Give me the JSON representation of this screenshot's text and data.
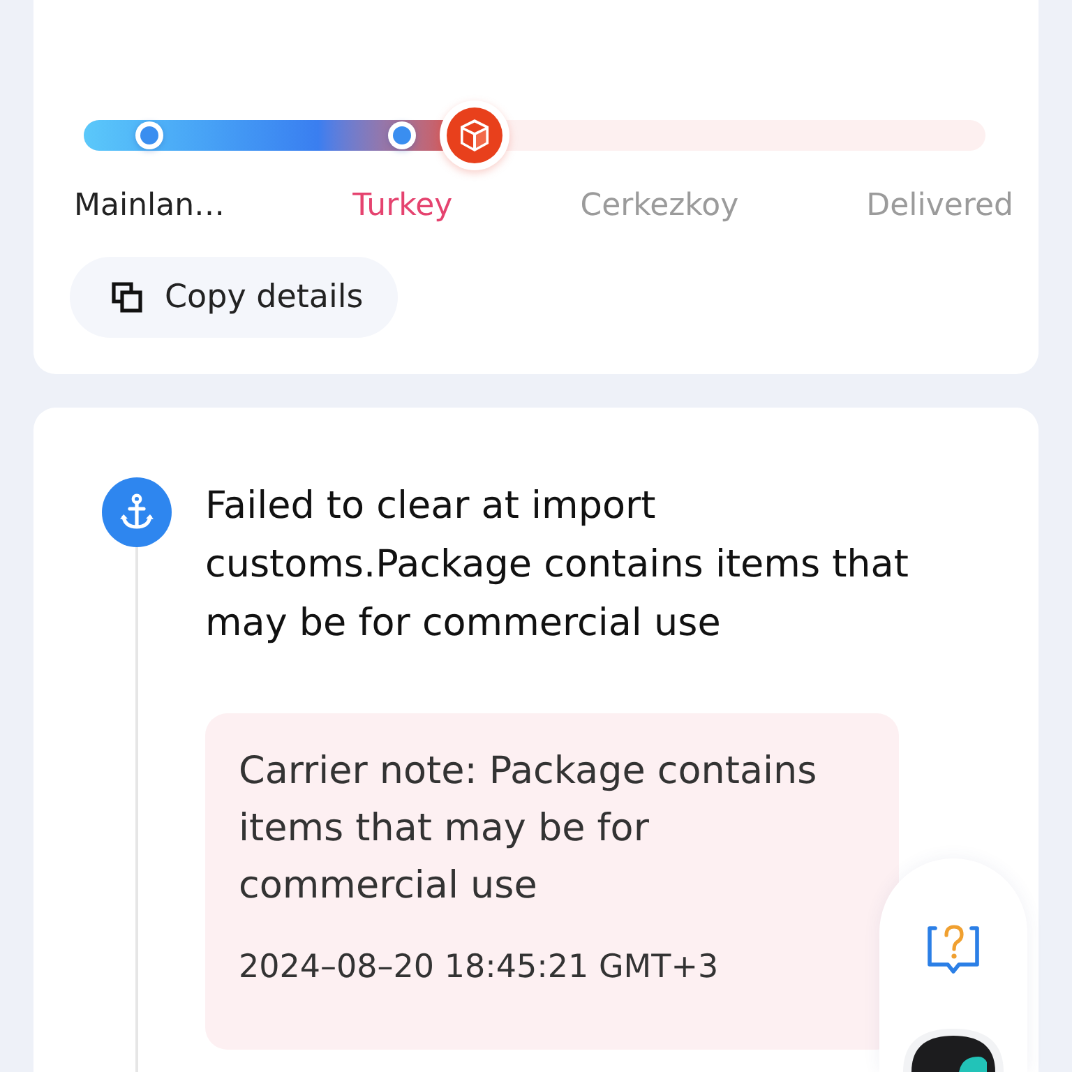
{
  "shipment_progress": {
    "level": 0.433,
    "stages": [
      {
        "label": "Mainlan…",
        "reached": true,
        "selected": false
      },
      {
        "label": "Turkey",
        "reached": true,
        "selected": true
      },
      {
        "label": "Cerkezkoy",
        "reached": false,
        "selected": false
      },
      {
        "label": "Delivered",
        "reached": false,
        "selected": false
      }
    ]
  },
  "copy_button": {
    "label": "Copy details"
  },
  "tracking_events": [
    {
      "title": "Failed to clear at import customs.Package contains items that may be for commercial use",
      "note": {
        "text": "Carrier note: Package contains items that may be for commercial use",
        "time": "2024–08–20 18:45:21 GMT+3"
      }
    }
  ]
}
